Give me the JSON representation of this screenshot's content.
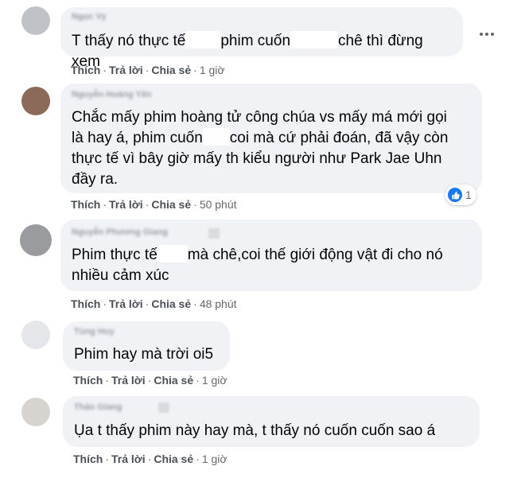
{
  "comments": [
    {
      "author": "Ngọc Vy",
      "parts": [
        "T thấy nó thực tế",
        "phim cuốn",
        "chê thì đừng xem"
      ],
      "like": "Thích",
      "reply": "Trả lời",
      "share": "Chia sẻ",
      "time": "1 giờ"
    },
    {
      "author": "Nguyễn Hoàng Yến",
      "lines": [
        "Chắc mấy phim hoàng tử công chúa vs mấy má mới gọi",
        "là hay á, phim cuốn",
        "coi mà cứ phải đoán, đã vậy còn",
        "thực tế vì bây giờ mấy th kiểu người như Park Jae Uhn",
        "đầy ra."
      ],
      "reaction_count": "1",
      "like": "Thích",
      "reply": "Trả lời",
      "share": "Chia sẻ",
      "time": "50 phút"
    },
    {
      "author": "Nguyễn Phương Giang",
      "lines": [
        "Phim thực tế",
        "mà chê,coi thế giới động vật đi cho nó",
        "nhiều cảm xúc"
      ],
      "like": "Thích",
      "reply": "Trả lời",
      "share": "Chia sẻ",
      "time": "48 phút"
    },
    {
      "author": "Tùng Huy",
      "lines": [
        "Phim hay mà trời oi5"
      ],
      "like": "Thích",
      "reply": "Trả lời",
      "share": "Chia sẻ",
      "time": "1 giờ"
    },
    {
      "author": "Thảo Giang",
      "lines": [
        "Ụa t thấy phim này hay mà, t thấy nó cuốn cuốn sao á"
      ],
      "like": "Thích",
      "reply": "Trả lời",
      "share": "Chia sẻ",
      "time": "1 giờ"
    }
  ],
  "icons": {
    "more": "more-horizontal-icon",
    "reaction": "like-reaction-icon"
  },
  "colors": {
    "bubble": "#f0f2f5",
    "like_blue": "#1877f2",
    "meta": "#65676b"
  }
}
